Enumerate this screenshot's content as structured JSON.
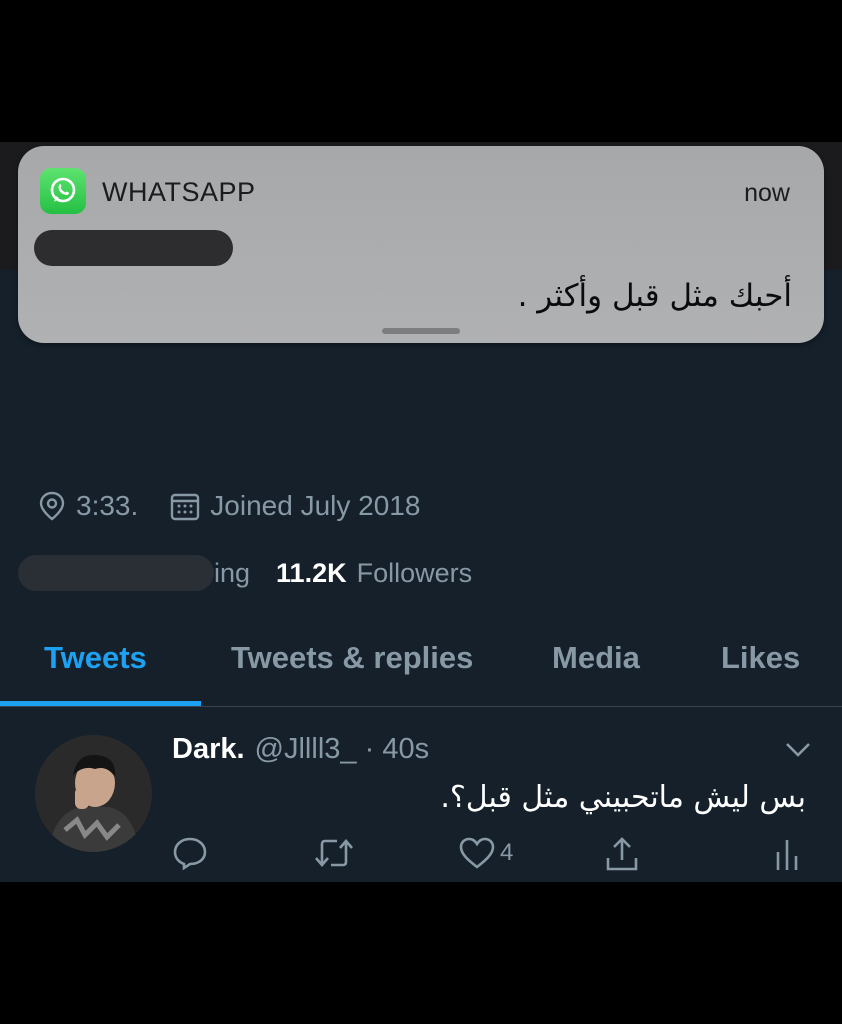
{
  "notification": {
    "app_name": "WHATSAPP",
    "time": "now",
    "message": "أحبك مثل قبل وأكثر ."
  },
  "profile": {
    "location": "3:33.",
    "joined": "Joined July 2018",
    "following_suffix": "ing",
    "followers_count": "11.2K",
    "followers_label": "Followers"
  },
  "tabs": [
    {
      "label": "Tweets",
      "active": true
    },
    {
      "label": "Tweets & replies",
      "active": false
    },
    {
      "label": "Media",
      "active": false
    },
    {
      "label": "Likes",
      "active": false
    }
  ],
  "tweet": {
    "name": "Dark.",
    "handle": "@Jllll3_",
    "separator": "·",
    "time": "40s",
    "text": "بس ليش ماتحبيني مثل قبل؟.",
    "likes": "4"
  },
  "colors": {
    "background": "#15202b",
    "accent": "#1da1f2",
    "secondary_text": "#8899a6",
    "whatsapp_green": "#25d366"
  },
  "icons": [
    "whatsapp-icon",
    "location-icon",
    "calendar-icon",
    "chevron-down-icon",
    "reply-icon",
    "retweet-icon",
    "heart-icon",
    "share-icon",
    "analytics-icon"
  ]
}
